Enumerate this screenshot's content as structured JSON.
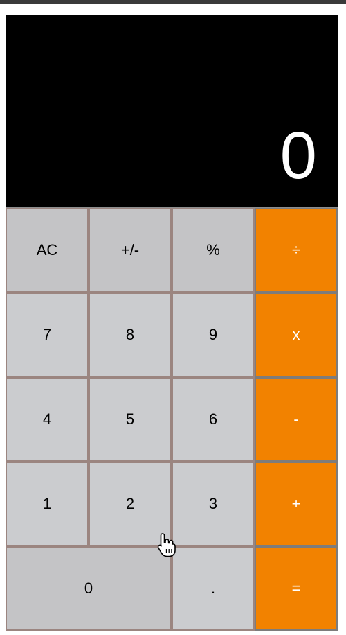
{
  "display": {
    "value": "0"
  },
  "keys": {
    "row1": [
      "AC",
      "+/-",
      "%",
      "÷"
    ],
    "row2": [
      "7",
      "8",
      "9",
      "x"
    ],
    "row3": [
      "4",
      "5",
      "6",
      "-"
    ],
    "row4": [
      "1",
      "2",
      "3",
      "+"
    ],
    "row5": [
      "0",
      ".",
      "="
    ]
  },
  "colors": {
    "display_bg": "#000000",
    "operator": "#f28200",
    "key": "#cbcccf",
    "function_key": "#c4c4c6"
  },
  "icons": {
    "cursor": "hand-pointer-icon"
  }
}
